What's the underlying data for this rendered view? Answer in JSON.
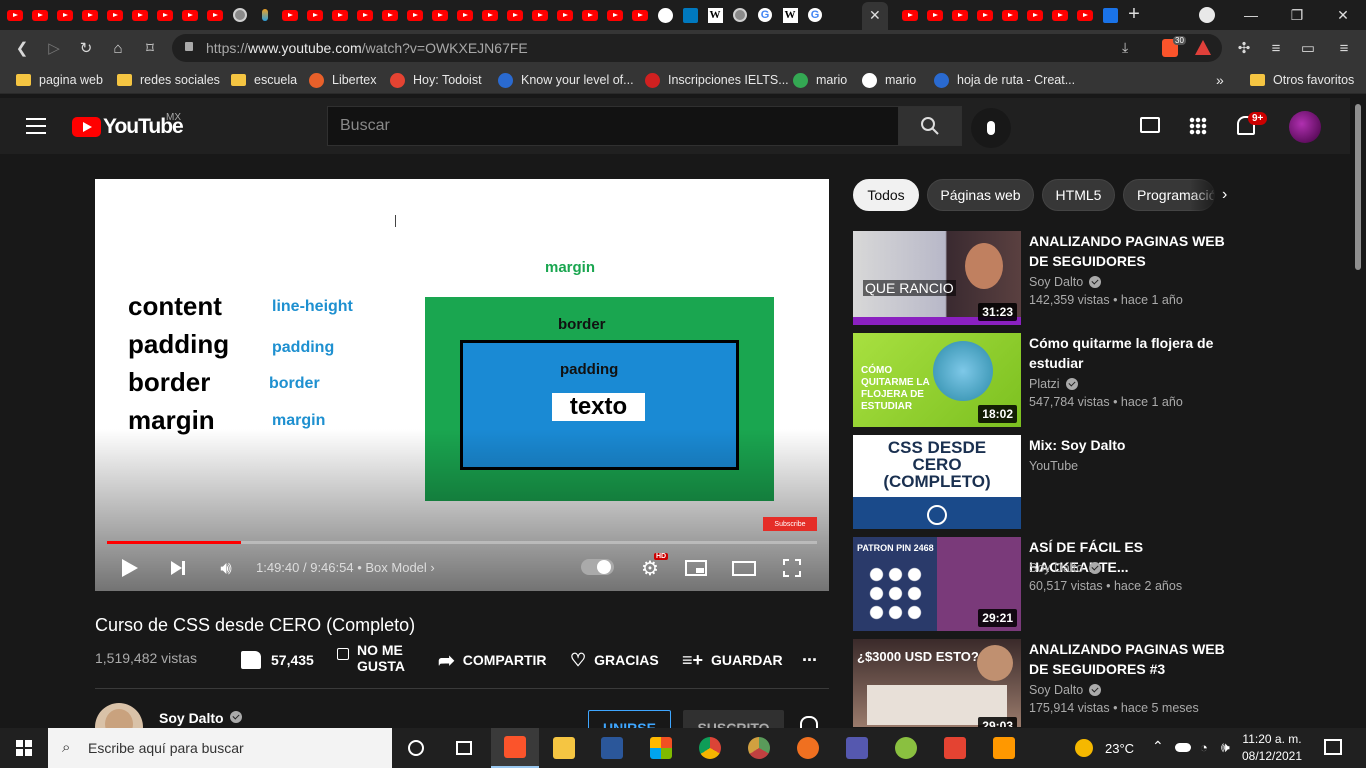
{
  "browser": {
    "url_prefix": "https://",
    "url_domain": "www.youtube.com",
    "url_path": "/watch?v=OWKXEJN67FE",
    "brave_badge": "30",
    "window_controls": [
      "—",
      "❐",
      "✕"
    ],
    "bookmarks": [
      {
        "label": "pagina web",
        "icon": "folder-icon"
      },
      {
        "label": "redes sociales",
        "icon": "folder-icon"
      },
      {
        "label": "escuela",
        "icon": "folder-icon"
      },
      {
        "label": "Libertex",
        "icon": "libertex-icon"
      },
      {
        "label": "Hoy: Todoist",
        "icon": "todoist-icon"
      },
      {
        "label": "Know your level of...",
        "icon": "site-icon"
      },
      {
        "label": "Inscripciones IELTS...",
        "icon": "ielts-icon"
      },
      {
        "label": "mario",
        "icon": "maps-icon"
      },
      {
        "label": "mario",
        "icon": "google-icon"
      },
      {
        "label": "hoja de ruta - Creat...",
        "icon": "site-icon"
      }
    ],
    "bookmarks_overflow": "»",
    "other_bookmarks": "Otros favoritos"
  },
  "youtube": {
    "logo_text": "YouTube",
    "region": "MX",
    "search_placeholder": "Buscar",
    "notif_badge": "9+",
    "player": {
      "slide_left": [
        "content",
        "padding",
        "border",
        "margin"
      ],
      "slide_right": [
        "line-height",
        "padding",
        "border",
        "margin"
      ],
      "label_margin": "margin",
      "label_border": "border",
      "label_padding": "padding",
      "label_texto": "texto",
      "subscribe_watermark": "Subscribe",
      "progress": 0.1885,
      "time_current": "1:49:40",
      "time_total": "9:46:54",
      "chapter": "Box Model",
      "hd_badge": "HD"
    },
    "video_title": "Curso de CSS desde CERO (Completo)",
    "views": "1,519,482 vistas",
    "like_count": "57,435",
    "dislike_label_1": "NO ME",
    "dislike_label_2": "GUSTA",
    "share_label": "COMPARTIR",
    "thanks_label": "GRACIAS",
    "save_label": "GUARDAR",
    "more_label": "...",
    "channel_name": "Soy Dalto",
    "join_label": "UNIRSE",
    "subscribed_label": "SUSCRITO",
    "chips": [
      "Todos",
      "Páginas web",
      "HTML5",
      "Programación"
    ],
    "recommendations": [
      {
        "title": "ANALIZANDO PAGINAS WEB DE SEGUIDORES",
        "channel": "Soy Dalto",
        "verified": true,
        "meta": "142,359 vistas • hace 1 año",
        "duration": "31:23",
        "thumb_text": "QUE RANCIO"
      },
      {
        "title": "Cómo quitarme la flojera de estudiar",
        "channel": "Platzi",
        "verified": true,
        "meta": "547,784 vistas • hace 1 año",
        "duration": "18:02",
        "thumb_text": "CÓMO QUITARME LA FLOJERA DE ESTUDIAR"
      },
      {
        "title": "Mix: Soy Dalto",
        "channel": "YouTube",
        "verified": false,
        "meta": "",
        "duration": "",
        "thumb_text": "CSS DESDE CERO (COMPLETO)"
      },
      {
        "title": "ASÍ DE FÁCIL ES HACKEARTE...",
        "channel": "Soy Dalto",
        "verified": true,
        "meta": "60,517 vistas • hace 2 años",
        "duration": "29:21",
        "thumb_text": "PATRON PIN 2468"
      },
      {
        "title": "ANALIZANDO PAGINAS WEB DE SEGUIDORES #3",
        "channel": "Soy Dalto",
        "verified": true,
        "meta": "175,914 vistas • hace 5 meses",
        "duration": "29:03",
        "thumb_text": "¿$3000 USD ESTO?"
      }
    ]
  },
  "taskbar": {
    "search_placeholder": "Escribe aquí para buscar",
    "weather": "23°C",
    "time": "11:20 a. m.",
    "date": "08/12/2021"
  },
  "colors": {
    "youtube_red": "#ff0000",
    "accent_blue": "#3ea6ff",
    "slide_green": "#1aa650",
    "slide_blue": "#1a8ad4"
  }
}
